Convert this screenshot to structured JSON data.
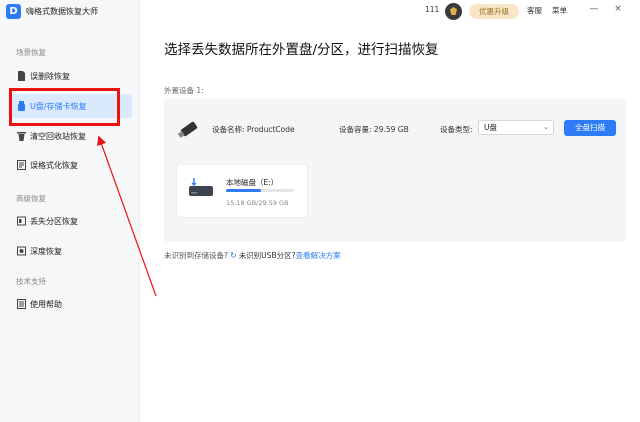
{
  "app": {
    "logo": "D",
    "title": "嗨格式数据恢复大师"
  },
  "topbar": {
    "count": "111",
    "upgrade_label": "优惠升级",
    "service": "客服",
    "menu": "菜单",
    "minimize": "—",
    "close": "×"
  },
  "sidebar": {
    "sections": [
      {
        "label": "场景恢复"
      },
      {
        "label": "高级恢复"
      },
      {
        "label": "技术支持"
      }
    ],
    "items": [
      {
        "label": "误删除恢复",
        "icon": "file-icon"
      },
      {
        "label": "U盘/存储卡恢复",
        "icon": "usb-icon",
        "active": true
      },
      {
        "label": "清空回收站恢复",
        "icon": "recycle-bin-icon"
      },
      {
        "label": "误格式化恢复",
        "icon": "format-icon"
      },
      {
        "label": "丢失分区恢复",
        "icon": "partition-icon"
      },
      {
        "label": "深度恢复",
        "icon": "deep-scan-icon"
      },
      {
        "label": "使用帮助",
        "icon": "help-icon"
      }
    ]
  },
  "main": {
    "title": "选择丢失数据所在外置盘/分区，进行扫描恢复",
    "device_section": "外置设备 1:",
    "device": {
      "name_label": "设备名称: ProductCode",
      "capacity_label": "设备容量: 29.59 GB",
      "type_label": "设备类型:",
      "type_value": "U盘",
      "scan_button": "全盘扫描"
    },
    "disk": {
      "name": "本地磁盘（E:）",
      "size": "15.18 GB/29.59 GB",
      "used_fraction": 0.513
    },
    "help": {
      "question": "未识别到存储设备?",
      "usb": "未识别USB分区?",
      "link": "查看解决方案"
    }
  },
  "colors": {
    "accent": "#2d7cf6",
    "annotation": "#e11111"
  }
}
